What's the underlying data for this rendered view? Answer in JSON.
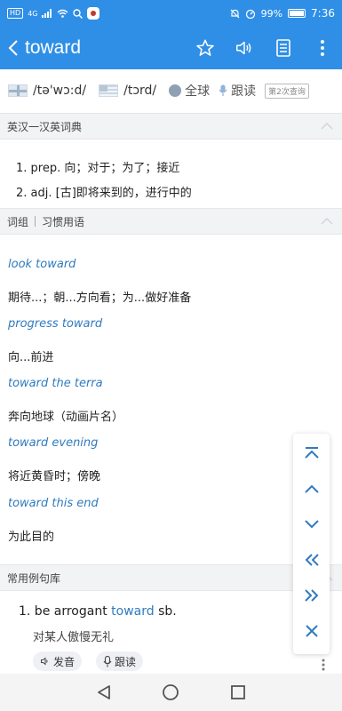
{
  "status": {
    "left_chip": "HD",
    "signal_label": "4G",
    "battery_text": "99%",
    "battery_level": 0.99,
    "time": "7:36"
  },
  "header": {
    "title": "toward",
    "icons": [
      "back-arrow-icon",
      "star-icon",
      "speaker-icon",
      "notebook-icon",
      "more-vertical-icon"
    ]
  },
  "pronunciation": {
    "uk": "/tə'wɔ:d/",
    "us": "/tɔrd/",
    "global": "全球",
    "follow": "跟读",
    "badge": "第2次查询"
  },
  "sections": {
    "dict": "英汉一汉英词典",
    "phrases_tab1": "词组",
    "phrases_tab2": "习惯用语",
    "examples": "常用例句库"
  },
  "definitions": [
    "1. prep. 向；对于；为了；接近",
    "2. adj. [古]即将来到的，进行中的"
  ],
  "phrases": [
    {
      "en": "look toward",
      "zh": "期待...；朝...方向看；为...做好准备"
    },
    {
      "en": "progress toward",
      "zh": "向...前进"
    },
    {
      "en": "toward the terra",
      "zh": "奔向地球（动画片名）"
    },
    {
      "en": "toward evening",
      "zh": "将近黄昏时；傍晚"
    },
    {
      "en": "toward this end",
      "zh": "为此目的"
    }
  ],
  "example": {
    "pre": "1. be arrogant ",
    "highlight": "toward",
    "post": " sb.",
    "zh": "对某人傲慢无礼",
    "btn_sound": "发音",
    "btn_follow": "跟读"
  },
  "colors": {
    "brand": "#2f8fe6",
    "link": "#2f7bbf"
  }
}
